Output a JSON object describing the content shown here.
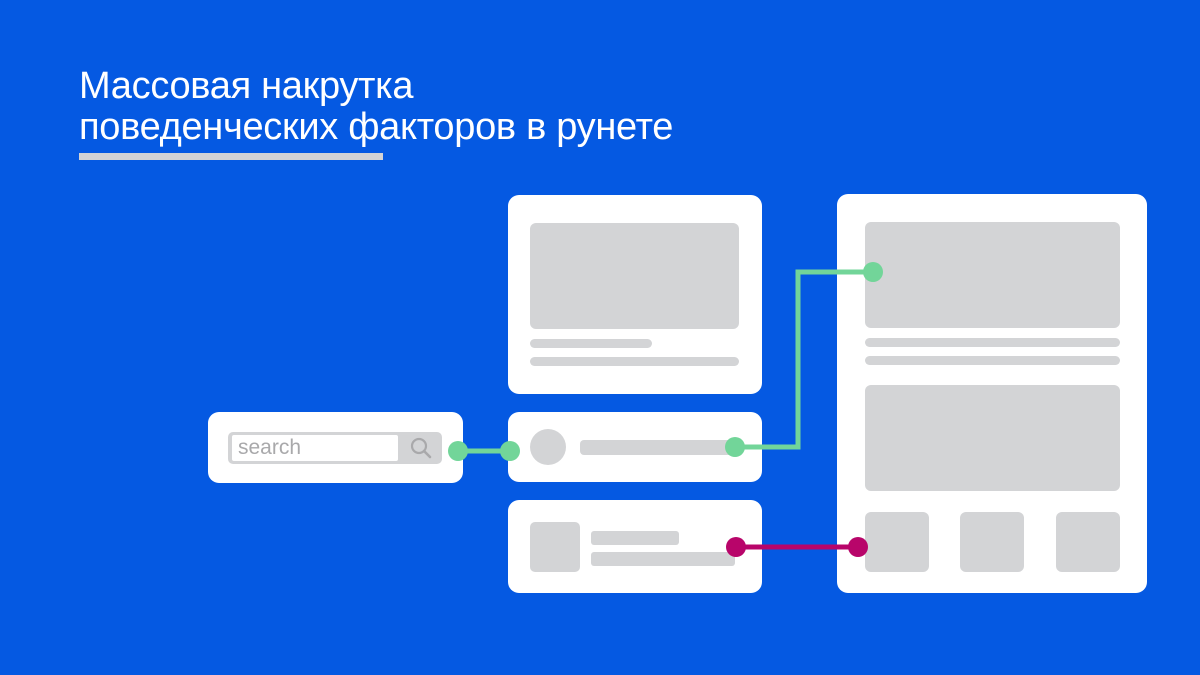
{
  "header": {
    "title_line1": "Массовая накрутка",
    "title_line2": "поведенческих факторов в рунете"
  },
  "search_widget": {
    "placeholder": "search",
    "icon": "magnifier-icon"
  },
  "colors": {
    "background": "#0559e2",
    "card": "#ffffff",
    "placeholder": "#d3d4d6",
    "connector_green": "#72d599",
    "connector_magenta": "#b8056a",
    "underline": "#d3d3d5"
  },
  "connections": [
    {
      "from": "search-card",
      "to": "search-result-card",
      "color": "green"
    },
    {
      "from": "search-result-card",
      "to": "page-hero-image",
      "color": "green"
    },
    {
      "from": "related-item-card",
      "to": "page-thumbnail-1",
      "color": "magenta"
    }
  ]
}
